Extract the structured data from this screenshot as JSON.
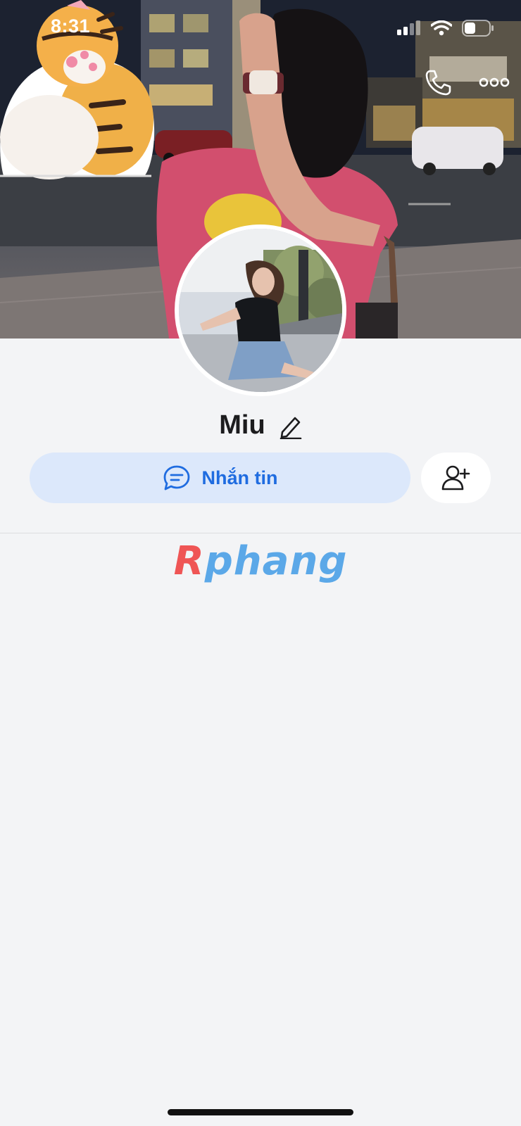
{
  "status_bar": {
    "time": "8:31"
  },
  "profile": {
    "name": "Miu"
  },
  "actions": {
    "message_label": "Nhắn tin"
  },
  "watermark": {
    "first": "R",
    "rest": "phang"
  },
  "icons": {
    "back": "chevron-left-icon",
    "call": "phone-icon",
    "more": "more-horizontal-icon",
    "edit": "pencil-icon",
    "message": "chat-bubble-icon",
    "add_friend": "user-plus-icon"
  },
  "colors": {
    "accent": "#1f6ce0",
    "message_button_bg": "#dce8fb",
    "page_bg": "#f3f4f6"
  }
}
